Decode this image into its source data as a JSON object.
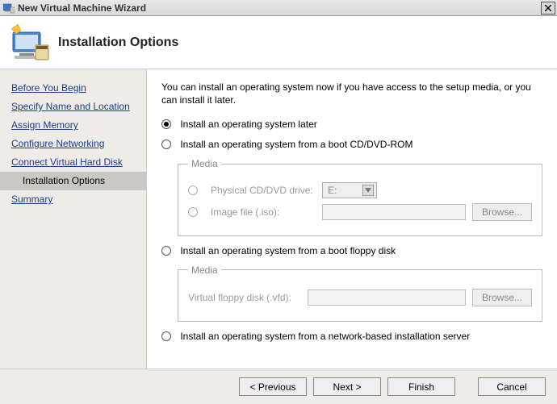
{
  "window": {
    "title": "New Virtual Machine Wizard"
  },
  "header": {
    "title": "Installation Options"
  },
  "sidebar": {
    "items": [
      {
        "label": "Before You Begin",
        "selected": false
      },
      {
        "label": "Specify Name and Location",
        "selected": false
      },
      {
        "label": "Assign Memory",
        "selected": false
      },
      {
        "label": "Configure Networking",
        "selected": false
      },
      {
        "label": "Connect Virtual Hard Disk",
        "selected": false
      },
      {
        "label": "Installation Options",
        "selected": true
      },
      {
        "label": "Summary",
        "selected": false
      }
    ]
  },
  "main": {
    "intro": "You can install an operating system now if you have access to the setup media, or you can install it later.",
    "options": {
      "later": {
        "label": "Install an operating system later",
        "checked": true
      },
      "cddvd": {
        "label": "Install an operating system from a boot CD/DVD-ROM",
        "checked": false,
        "group_label": "Media",
        "physical_label": "Physical CD/DVD drive:",
        "physical_value": "E:",
        "image_label": "Image file (.iso):",
        "image_value": "",
        "browse_label": "Browse..."
      },
      "floppy": {
        "label": "Install an operating system from a boot floppy disk",
        "checked": false,
        "group_label": "Media",
        "vfd_label": "Virtual floppy disk (.vfd):",
        "vfd_value": "",
        "browse_label": "Browse..."
      },
      "network": {
        "label": "Install an operating system from a network-based installation server",
        "checked": false
      }
    }
  },
  "footer": {
    "previous": "< Previous",
    "next": "Next >",
    "finish": "Finish",
    "cancel": "Cancel"
  }
}
